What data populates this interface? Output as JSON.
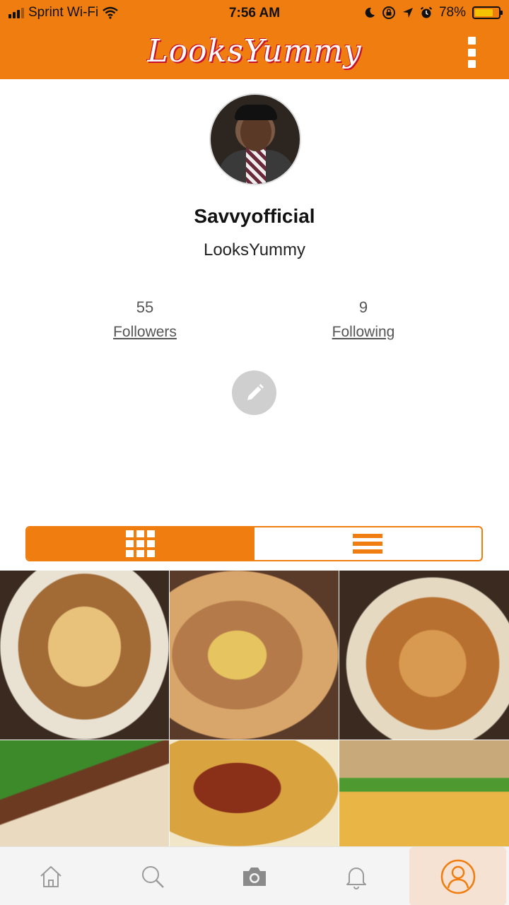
{
  "status_bar": {
    "carrier": "Sprint Wi-Fi",
    "time": "7:56 AM",
    "battery": "78%",
    "battery_level": 0.78,
    "icons": [
      "signal-icon",
      "wifi-icon",
      "moon-icon",
      "orientation-lock-icon",
      "location-arrow-icon",
      "alarm-icon",
      "battery-icon"
    ]
  },
  "header": {
    "logo": "LooksYummy",
    "menu_icon": "kebab-menu-icon"
  },
  "profile": {
    "username": "Savvyofficial",
    "display_name": "LooksYummy",
    "followers_count": "55",
    "followers_label": "Followers",
    "following_count": "9",
    "following_label": "Following",
    "edit_icon": "pencil-icon"
  },
  "view_toggle": {
    "active": "grid",
    "options": [
      "grid-view-icon",
      "list-view-icon"
    ]
  },
  "photos": [
    {
      "subject": "rice-enchilada-plate"
    },
    {
      "subject": "corn-crab-boil"
    },
    {
      "subject": "fried-seafood-platter"
    },
    {
      "subject": "green-beans-mac-cheese"
    },
    {
      "subject": "wings-curly-fries"
    },
    {
      "subject": "burger-fries"
    }
  ],
  "bottom_nav": {
    "active": "profile",
    "items": [
      "home-icon",
      "search-icon",
      "camera-icon",
      "bell-icon",
      "profile-icon"
    ]
  },
  "colors": {
    "brand_orange": "#ef7d0f",
    "logo_red": "#c8102e",
    "edit_button_gray": "#cfcfcf",
    "active_nav_bg": "#f6e2d3"
  }
}
